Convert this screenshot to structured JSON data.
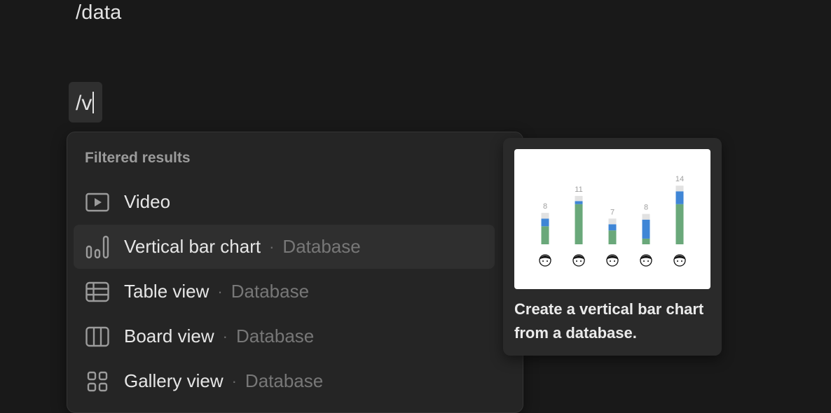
{
  "editor": {
    "previous_line": "/data",
    "slash_query": "/v"
  },
  "menu": {
    "header": "Filtered results",
    "items": [
      {
        "icon": "video-icon",
        "label": "Video",
        "sub": ""
      },
      {
        "icon": "vertical-bar-chart-icon",
        "label": "Vertical bar chart",
        "sub": "Database",
        "active": true
      },
      {
        "icon": "table-icon",
        "label": "Table view",
        "sub": "Database"
      },
      {
        "icon": "board-icon",
        "label": "Board view",
        "sub": "Database"
      },
      {
        "icon": "gallery-icon",
        "label": "Gallery view",
        "sub": "Database"
      }
    ]
  },
  "preview": {
    "description": "Create a vertical bar chart from a database.",
    "colors": {
      "green": "#6aa87a",
      "blue": "#3f86d6",
      "gray": "#e2e2e2",
      "label": "#a0a0a0"
    },
    "chart": {
      "totals": [
        "8",
        "11",
        "7",
        "8",
        "14"
      ],
      "bars": [
        {
          "green": 3.5,
          "blue": 1.5,
          "gray": 1.1
        },
        {
          "green": 7.8,
          "blue": 0.6,
          "gray": 1.0
        },
        {
          "green": 2.7,
          "blue": 1.2,
          "gray": 1.1
        },
        {
          "green": 1.1,
          "blue": 3.7,
          "gray": 1.1
        },
        {
          "green": 7.8,
          "blue": 2.5,
          "gray": 1.1
        }
      ]
    }
  }
}
